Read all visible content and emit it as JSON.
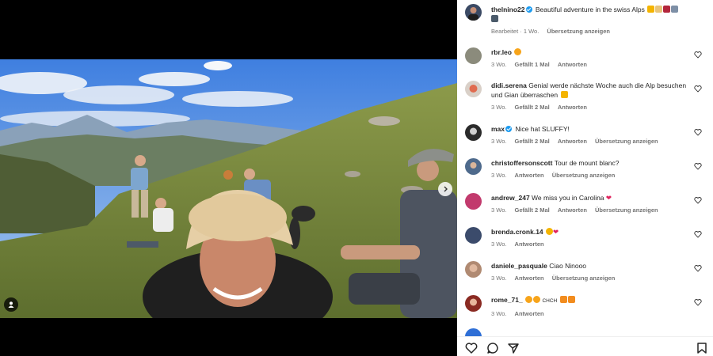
{
  "post": {
    "author": "thelnino22",
    "caption": "Beautiful adventure in the swiss Alps",
    "edited": "Bearbeitet · 1 Wo.",
    "translate": "Übersetzung anzeigen"
  },
  "comments": [
    {
      "user": "rbr.leo",
      "text": "",
      "time": "3 Wo.",
      "likes": "Gefällt 1 Mal",
      "reply": "Antworten",
      "translate": ""
    },
    {
      "user": "didi.serena",
      "text": "Genial werde nächste Woche auch die Alp besuchen und Gian überraschen",
      "time": "3 Wo.",
      "likes": "Gefällt 2 Mal",
      "reply": "Antworten",
      "translate": ""
    },
    {
      "user": "max",
      "text": "Nice hat SLUFFY!",
      "time": "3 Wo.",
      "likes": "Gefällt 2 Mal",
      "reply": "Antworten",
      "translate": "Übersetzung anzeigen"
    },
    {
      "user": "christoffersonscott",
      "text": "Tour de mount blanc?",
      "time": "3 Wo.",
      "likes": "",
      "reply": "Antworten",
      "translate": "Übersetzung anzeigen"
    },
    {
      "user": "andrew_247",
      "text": "We miss you in Carolina",
      "time": "3 Wo.",
      "likes": "Gefällt 2 Mal",
      "reply": "Antworten",
      "translate": "Übersetzung anzeigen"
    },
    {
      "user": "brenda.cronk.14",
      "text": "",
      "time": "3 Wo.",
      "likes": "",
      "reply": "Antworten",
      "translate": ""
    },
    {
      "user": "daniele_pasquale",
      "text": "Ciao Ninooo",
      "time": "3 Wo.",
      "likes": "",
      "reply": "Antworten",
      "translate": "Übersetzung anzeigen"
    },
    {
      "user": "rome_71_",
      "text": "CHCH",
      "time": "3 Wo.",
      "likes": "",
      "reply": "Antworten",
      "translate": ""
    }
  ],
  "icons": {
    "like": "heart-icon",
    "comment": "comment-icon",
    "share": "share-icon",
    "save": "bookmark-icon",
    "next": "chevron-right-icon",
    "tag": "user-tag-icon"
  },
  "colors": {
    "heart": "#e0245e",
    "link": "#737373",
    "verified": "#1d9bf0"
  }
}
